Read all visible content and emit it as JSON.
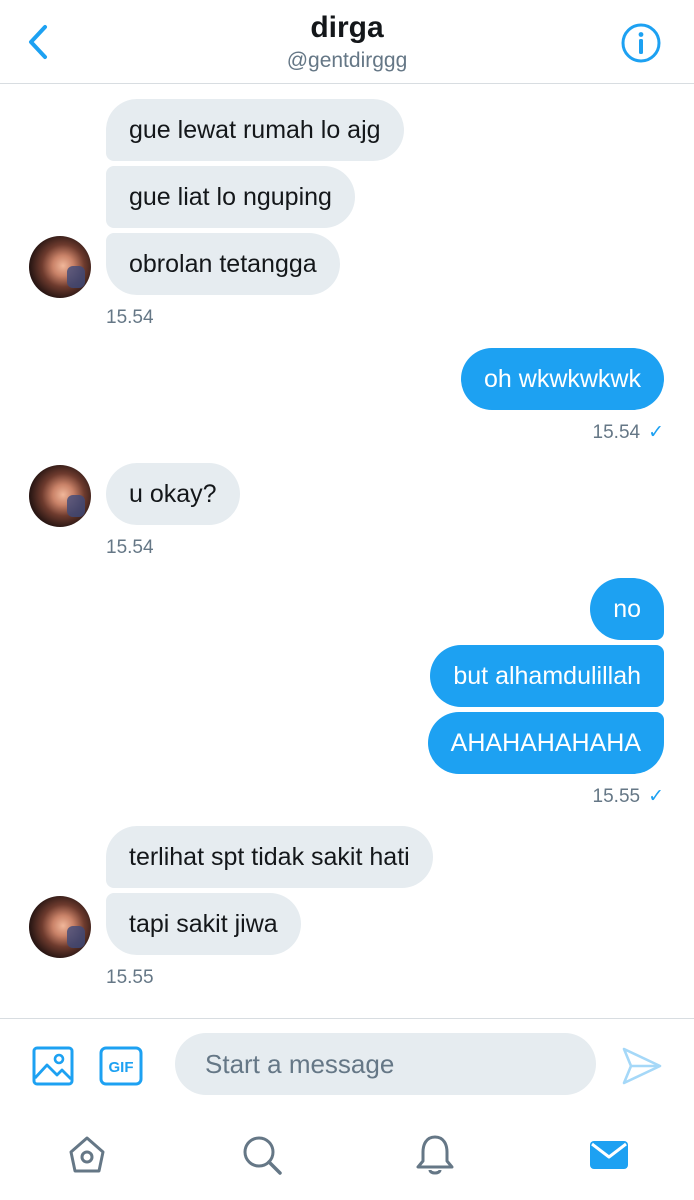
{
  "header": {
    "title": "dirga",
    "handle": "@gentdirggg",
    "back_icon": "chevron-left-icon",
    "info_icon": "info-icon"
  },
  "messages": {
    "group1": {
      "lines": [
        "gue lewat rumah lo ajg",
        "gue liat lo nguping",
        "obrolan tetangga"
      ],
      "time": "15.54"
    },
    "group2": {
      "lines": [
        "oh wkwkwkwk"
      ],
      "time": "15.54"
    },
    "group3": {
      "lines": [
        "u okay?"
      ],
      "time": "15.54"
    },
    "group4": {
      "lines": [
        "no",
        "but alhamdulillah",
        "AHAHAHAHAHA"
      ],
      "time": "15.55"
    },
    "group5": {
      "lines": [
        "terlihat spt tidak sakit hati",
        "tapi sakit jiwa"
      ],
      "time": "15.55"
    }
  },
  "composer": {
    "placeholder": "Start a message",
    "gif_label": "GIF"
  },
  "tabs": [
    "home-icon",
    "search-icon",
    "notifications-icon",
    "messages-icon"
  ],
  "colors": {
    "accent": "#1da1f2",
    "incoming_bubble": "#e6ecf0",
    "muted_text": "#657786",
    "divider": "#d8dde1"
  }
}
